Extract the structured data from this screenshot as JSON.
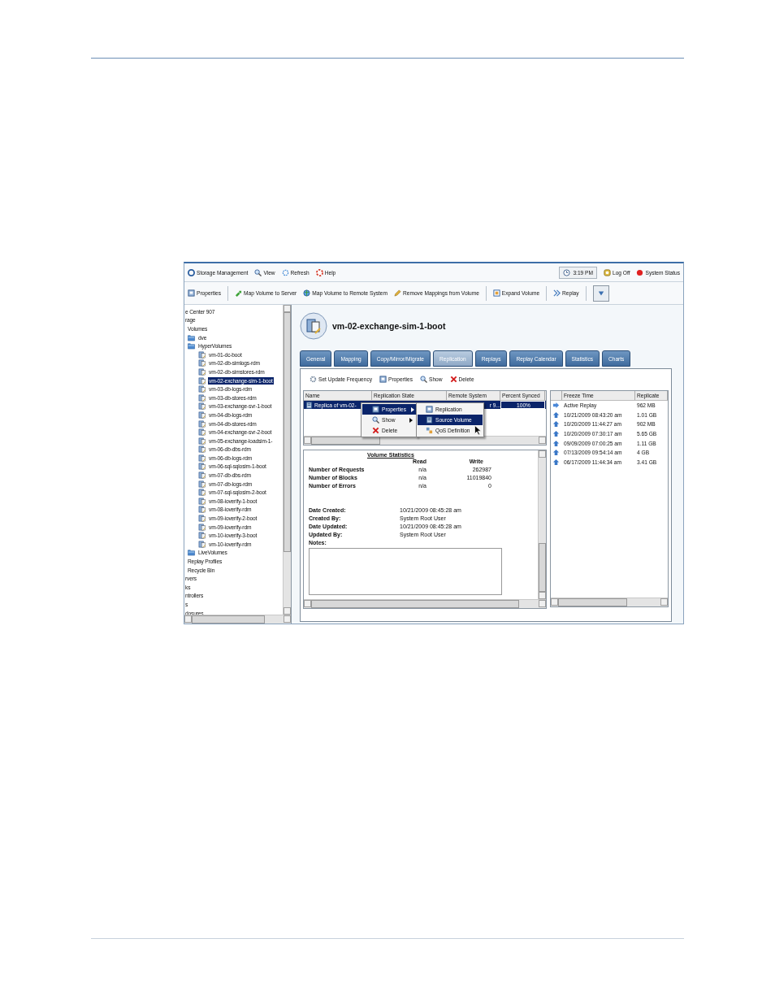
{
  "menu_bar": {
    "items": [
      {
        "kind": "app",
        "label": "Storage Management"
      },
      {
        "kind": "view",
        "label": "View"
      },
      {
        "kind": "refresh",
        "label": "Refresh"
      },
      {
        "kind": "help",
        "label": "Help"
      }
    ],
    "clock": "3:19 PM",
    "log_off": "Log Off",
    "system_status": "System Status"
  },
  "toolbar": {
    "items": [
      {
        "kind": "properties",
        "label": "Properties"
      },
      {
        "kind": "map",
        "label": "Map Volume to Server"
      },
      {
        "kind": "remote",
        "label": "Map Volume to Remote System"
      },
      {
        "kind": "remove",
        "label": "Remove Mappings from Volume"
      },
      {
        "kind": "expand",
        "label": "Expand Volume"
      },
      {
        "kind": "replay",
        "label": "Replay"
      }
    ]
  },
  "tree": [
    {
      "label": "e Center 907",
      "selected": false,
      "children": [
        {
          "label": "rage",
          "selected": false,
          "children": [
            {
              "label": "Volumes",
              "selected": false,
              "children": [
                {
                  "kind": "folder",
                  "label": "dve",
                  "selected": false
                },
                {
                  "kind": "folder",
                  "label": "HyperVolumes",
                  "selected": false,
                  "children": [
                    {
                      "kind": "volume",
                      "label": "vm-01-dc-boot",
                      "selected": false
                    },
                    {
                      "kind": "volume",
                      "label": "vm-02-db-simlogs-rdm",
                      "selected": false
                    },
                    {
                      "kind": "volume",
                      "label": "vm-02-db-simstores-rdm",
                      "selected": false
                    },
                    {
                      "kind": "volume",
                      "label": "vm-02-exchange-sim-1-boot",
                      "selected": true
                    },
                    {
                      "kind": "volume",
                      "label": "vm-03-db-logs-rdm",
                      "selected": false
                    },
                    {
                      "kind": "volume",
                      "label": "vm-03-db-stores-rdm",
                      "selected": false
                    },
                    {
                      "kind": "volume",
                      "label": "vm-03-exchange-svr-1-boot",
                      "selected": false
                    },
                    {
                      "kind": "volume",
                      "label": "vm-04-db-logs-rdm",
                      "selected": false
                    },
                    {
                      "kind": "volume",
                      "label": "vm-04-db-stores-rdm",
                      "selected": false
                    },
                    {
                      "kind": "volume",
                      "label": "vm-04-exchange-svr-2-boot",
                      "selected": false
                    },
                    {
                      "kind": "volume",
                      "label": "vm-05-exchange-loadsim-1-",
                      "selected": false
                    },
                    {
                      "kind": "volume",
                      "label": "vm-06-db-dbs-rdm",
                      "selected": false
                    },
                    {
                      "kind": "volume",
                      "label": "vm-06-db-logs-rdm",
                      "selected": false
                    },
                    {
                      "kind": "volume",
                      "label": "vm-06-sql-sqlosim-1-boot",
                      "selected": false
                    },
                    {
                      "kind": "volume",
                      "label": "vm-07-db-dbs-rdm",
                      "selected": false
                    },
                    {
                      "kind": "volume",
                      "label": "vm-07-db-logs-rdm",
                      "selected": false
                    },
                    {
                      "kind": "volume",
                      "label": "vm-07-sql-sqlosim-2-boot",
                      "selected": false
                    },
                    {
                      "kind": "volume",
                      "label": "vm-08-ioverify-1-boot",
                      "selected": false
                    },
                    {
                      "kind": "volume",
                      "label": "vm-08-ioverify-rdm",
                      "selected": false
                    },
                    {
                      "kind": "volume",
                      "label": "vm-09-ioverify-2-boot",
                      "selected": false
                    },
                    {
                      "kind": "volume",
                      "label": "vm-09-ioverify-rdm",
                      "selected": false
                    },
                    {
                      "kind": "volume",
                      "label": "vm-10-ioverify-3-boot",
                      "selected": false
                    },
                    {
                      "kind": "volume",
                      "label": "vm-10-ioverify-rdm",
                      "selected": false
                    }
                  ]
                },
                {
                  "kind": "folder",
                  "label": "LiveVolumes",
                  "selected": false
                },
                {
                  "label": "Replay Profiles",
                  "selected": false
                },
                {
                  "label": "Recycle Bin",
                  "selected": false
                }
              ]
            }
          ]
        },
        {
          "label": "rvers",
          "selected": false
        },
        {
          "label": "ks",
          "selected": false
        },
        {
          "label": "ntrollers",
          "selected": false
        },
        {
          "label": "s",
          "selected": false
        },
        {
          "label": "dosures",
          "selected": false
        }
      ]
    }
  ],
  "volume": {
    "title": "vm-02-exchange-sim-1-boot"
  },
  "tabs": [
    {
      "label": "General",
      "selected": false
    },
    {
      "label": "Mapping",
      "selected": false
    },
    {
      "label": "Copy/Mirror/Migrate",
      "selected": false
    },
    {
      "label": "Replication",
      "selected": true
    },
    {
      "label": "Replays",
      "selected": false
    },
    {
      "label": "Replay Calendar",
      "selected": false
    },
    {
      "label": "Statistics",
      "selected": false
    },
    {
      "label": "Charts",
      "selected": false
    }
  ],
  "actions": [
    {
      "kind": "frequency",
      "label": "Set Update Frequency"
    },
    {
      "kind": "properties",
      "label": "Properties"
    },
    {
      "kind": "show",
      "label": "Show"
    },
    {
      "kind": "delete",
      "label": "Delete"
    }
  ],
  "replications": {
    "columns": [
      "Name",
      "Replication State",
      "Remote System",
      "Percent Synced"
    ],
    "rows": [
      {
        "name": "Replica of vm-02-",
        "remote_system": "r 9...",
        "percent_synced": "100%",
        "selected": true
      }
    ]
  },
  "context_menu": {
    "items": [
      {
        "kind": "properties",
        "label": "Properties",
        "submenu": true,
        "selected": true
      },
      {
        "kind": "show",
        "label": "Show",
        "submenu": true,
        "selected": false
      },
      {
        "kind": "delete",
        "label": "Delete",
        "submenu": false,
        "selected": false
      }
    ],
    "submenu": [
      {
        "kind": "replication",
        "label": "Replication",
        "selected": false
      },
      {
        "kind": "source",
        "label": "Source Volume",
        "selected": true
      },
      {
        "kind": "qos",
        "label": "QoS Definition",
        "selected": false
      }
    ]
  },
  "statistics": {
    "title": "Volume Statistics",
    "columns": [
      "Read",
      "Write"
    ],
    "rows": [
      {
        "label": "Number of Requests",
        "read": "n/a",
        "write": "262987"
      },
      {
        "label": "Number of Blocks",
        "read": "n/a",
        "write": "11019840"
      },
      {
        "label": "Number of Errors",
        "read": "n/a",
        "write": "0"
      }
    ],
    "details": [
      {
        "label": "Date Created:",
        "value": "10/21/2009 08:45:28 am"
      },
      {
        "label": "Created By:",
        "value": "System Root User"
      },
      {
        "label": "Date Updated:",
        "value": "10/21/2009 08:45:28 am"
      },
      {
        "label": "Updated By:",
        "value": "System Root User"
      }
    ],
    "notes_label": "Notes:"
  },
  "replays": {
    "columns": [
      "Freeze Time",
      "Replicate"
    ],
    "rows": [
      {
        "kind": "active",
        "freeze_time": "Active Replay",
        "replicated": "962 MB"
      },
      {
        "kind": "replay",
        "freeze_time": "10/21/2009 08:43:20 am",
        "replicated": "1.01 GB"
      },
      {
        "kind": "replay",
        "freeze_time": "10/20/2009 11:44:27 am",
        "replicated": "902 MB"
      },
      {
        "kind": "replay",
        "freeze_time": "10/20/2009 07:30:17 am",
        "replicated": "5.65 GB"
      },
      {
        "kind": "replay",
        "freeze_time": "09/09/2009 07:00:25 am",
        "replicated": "1.11 GB"
      },
      {
        "kind": "replay",
        "freeze_time": "07/13/2009 09:54:14 am",
        "replicated": "4 GB"
      },
      {
        "kind": "replay",
        "freeze_time": "06/17/2009 11:44:34 am",
        "replicated": "3.41 GB"
      }
    ]
  }
}
